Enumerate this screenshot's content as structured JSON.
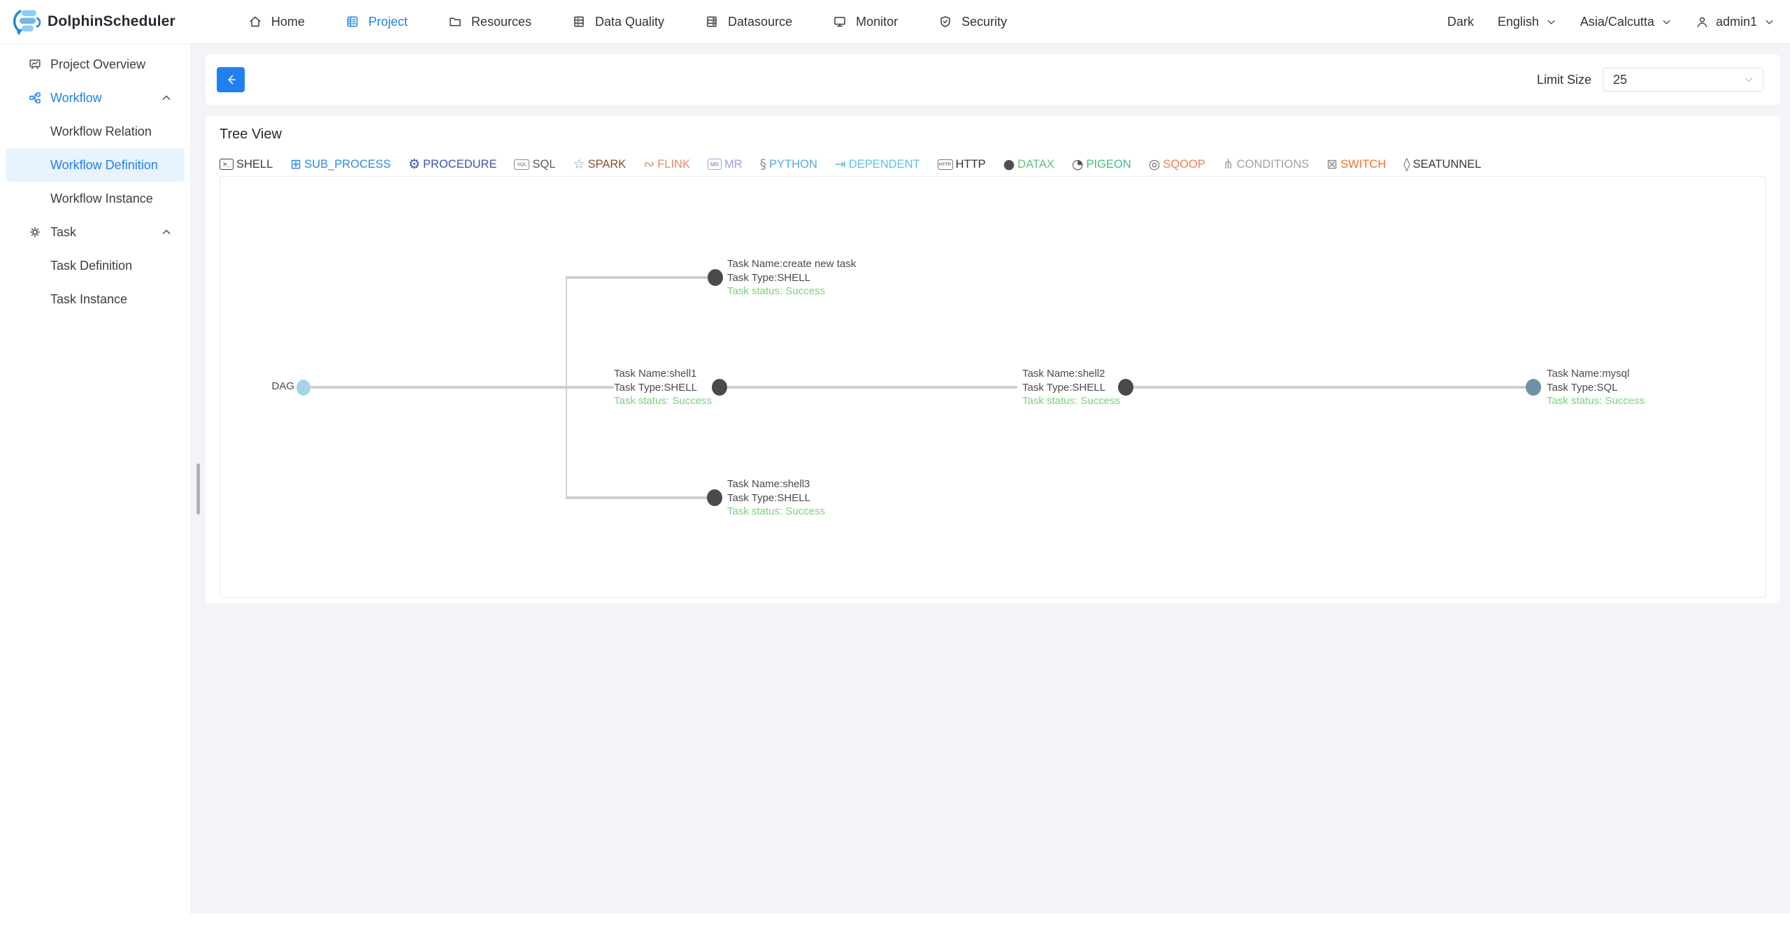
{
  "colors": {
    "primary": "#2080f0",
    "status_success_green": "#79d17a",
    "tree_line": "#cfcfcf",
    "node_circle_dark": "#4a4a4a",
    "node_circle_sql": "#6e92a3",
    "dag_circle": "#a7d3e9",
    "sidebar_selected_bg": "#e8f3fd"
  },
  "navbar": {
    "logo_text": "DolphinScheduler",
    "menu": [
      {
        "label": "Home",
        "icon": "home-icon",
        "active": false
      },
      {
        "label": "Project",
        "icon": "project-icon",
        "active": true
      },
      {
        "label": "Resources",
        "icon": "folder-icon",
        "active": false
      },
      {
        "label": "Data Quality",
        "icon": "data-quality-icon",
        "active": false
      },
      {
        "label": "Datasource",
        "icon": "datasource-icon",
        "active": false
      },
      {
        "label": "Monitor",
        "icon": "monitor-icon",
        "active": false
      },
      {
        "label": "Security",
        "icon": "security-icon",
        "active": false
      }
    ],
    "right": {
      "theme_label": "Dark",
      "language": "English",
      "timezone": "Asia/Calcutta",
      "username": "admin1"
    }
  },
  "sidebar": {
    "items": [
      {
        "label": "Project Overview",
        "icon": "overview-icon",
        "child": false,
        "active": false,
        "selected": false,
        "chevron": ""
      },
      {
        "label": "Workflow",
        "icon": "workflow-icon",
        "child": false,
        "active": true,
        "selected": false,
        "chevron": "up"
      },
      {
        "label": "Workflow Relation",
        "icon": "",
        "child": true,
        "active": false,
        "selected": false,
        "chevron": ""
      },
      {
        "label": "Workflow Definition",
        "icon": "",
        "child": true,
        "active": false,
        "selected": true,
        "chevron": ""
      },
      {
        "label": "Workflow Instance",
        "icon": "",
        "child": true,
        "active": false,
        "selected": false,
        "chevron": ""
      },
      {
        "label": "Task",
        "icon": "task-icon",
        "child": false,
        "active": false,
        "selected": false,
        "chevron": "up"
      },
      {
        "label": "Task Definition",
        "icon": "",
        "child": true,
        "active": false,
        "selected": false,
        "chevron": ""
      },
      {
        "label": "Task Instance",
        "icon": "",
        "child": true,
        "active": false,
        "selected": false,
        "chevron": ""
      }
    ]
  },
  "toolbar": {
    "limit_size_label": "Limit Size",
    "limit_size_value": "25"
  },
  "tree_view": {
    "title": "Tree View",
    "legend": [
      {
        "label": "SHELL",
        "icon": "terminal-icon",
        "label_color": "#3d3d3d",
        "icon_color": "#3d3d3d"
      },
      {
        "label": "SUB_PROCESS",
        "icon": "sitemap-icon",
        "label_color": "#2e8ae0",
        "icon_color": "#2e8ae0"
      },
      {
        "label": "PROCEDURE",
        "icon": "database-gear-icon",
        "label_color": "#3f51b5",
        "icon_color": "#3f51b5"
      },
      {
        "label": "SQL",
        "icon": "database-sql-icon",
        "label_color": "#5a5a5a",
        "icon_color": "#8a8a8a"
      },
      {
        "label": "SPARK",
        "icon": "star-icon",
        "label_color": "#8a4e2a",
        "icon_color": "#8f8f8f"
      },
      {
        "label": "FLINK",
        "icon": "squirrel-icon",
        "label_color": "#e88a66",
        "icon_color": "#e88a66"
      },
      {
        "label": "MR",
        "icon": "mr-box-icon",
        "label_color": "#9ba3e0",
        "icon_color": "#9ba3e0"
      },
      {
        "label": "PYTHON",
        "icon": "python-icon",
        "label_color": "#55a9e2",
        "icon_color": "#8f8f8f"
      },
      {
        "label": "DEPENDENT",
        "icon": "dependent-icon",
        "label_color": "#5cc2e8",
        "icon_color": "#7ab8d8"
      },
      {
        "label": "HTTP",
        "icon": "http-icon",
        "label_color": "#333333",
        "icon_color": "#777777"
      },
      {
        "label": "DATAX",
        "icon": "datax-circle-icon",
        "label_color": "#66c27e",
        "icon_color": "#4f4f4f"
      },
      {
        "label": "PIGEON",
        "icon": "pigeon-icon",
        "label_color": "#45bd84",
        "icon_color": "#555555"
      },
      {
        "label": "SQOOP",
        "icon": "ring-icon",
        "label_color": "#ee7f55",
        "icon_color": "#6a6a6a"
      },
      {
        "label": "CONDITIONS",
        "icon": "branch-icon",
        "label_color": "#9aa4aa",
        "icon_color": "#9aa4aa"
      },
      {
        "label": "SWITCH",
        "icon": "switch-box-icon",
        "label_color": "#f56f2c",
        "icon_color": "#8f8f8f"
      },
      {
        "label": "SEATUNNEL",
        "icon": "droplet-icon",
        "label_color": "#383838",
        "icon_color": "#666666"
      }
    ],
    "root_label": "DAG",
    "nodes": [
      {
        "id": "create-new-task",
        "name_line": "Task Name:create new task",
        "type_line": "Task Type:SHELL",
        "status_line": "Task status: Success"
      },
      {
        "id": "shell1",
        "name_line": "Task Name:shell1",
        "type_line": "Task Type:SHELL",
        "status_line": "Task status: Success"
      },
      {
        "id": "shell2",
        "name_line": "Task Name:shell2",
        "type_line": "Task Type:SHELL",
        "status_line": "Task status: Success"
      },
      {
        "id": "mysql",
        "name_line": "Task Name:mysql",
        "type_line": "Task Type:SQL",
        "status_line": "Task status: Success"
      },
      {
        "id": "shell3",
        "name_line": "Task Name:shell3",
        "type_line": "Task Type:SHELL",
        "status_line": "Task status: Success"
      }
    ]
  }
}
